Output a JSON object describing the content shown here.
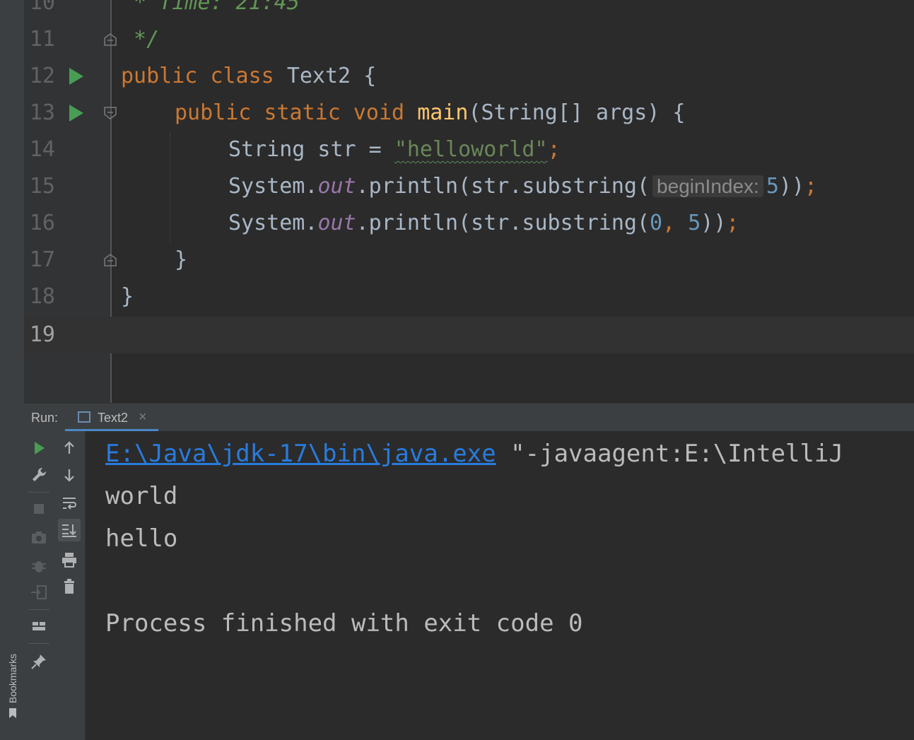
{
  "editor": {
    "lines": [
      {
        "num": "10",
        "text": " * Time: 21:45"
      },
      {
        "num": "11",
        "text": " */"
      },
      {
        "num": "12",
        "kw1": "public",
        "kw2": "class",
        "name": "Text2",
        "brace": "{"
      },
      {
        "num": "13",
        "kw1": "public",
        "kw2": "static",
        "kw3": "void",
        "fn": "main",
        "params": "(String[] args) {"
      },
      {
        "num": "14",
        "type": "String str = ",
        "str": "\"helloworld\"",
        "semi": ";"
      },
      {
        "num": "15",
        "pre": "System.",
        "field": "out",
        "call": ".println(str.substring(",
        "hint": "beginIndex:",
        "arg": "5",
        "close": "))",
        "semi": ";"
      },
      {
        "num": "16",
        "pre": "System.",
        "field": "out",
        "call": ".println(str.substring(",
        "arg1": "0",
        "comma": ", ",
        "arg2": "5",
        "close": "))",
        "semi": ";"
      },
      {
        "num": "17",
        "text": "}"
      },
      {
        "num": "18",
        "text": "}"
      },
      {
        "num": "19",
        "text": ""
      }
    ]
  },
  "run_panel": {
    "label": "Run:",
    "tab_label": "Text2",
    "tab_close": "×"
  },
  "console": {
    "command_link": "E:\\Java\\jdk-17\\bin\\java.exe",
    "command_rest": " \"-javaagent:E:\\IntelliJ",
    "output": [
      "world",
      "hello"
    ],
    "exit_message": "Process finished with exit code 0"
  },
  "side": {
    "bookmarks_label": "Bookmarks"
  },
  "colors": {
    "keyword": "#cc7832",
    "string": "#6a8759",
    "number": "#6897bb",
    "function": "#ffc66d",
    "field": "#9876aa",
    "link": "#287bde",
    "run_green": "#499c54"
  }
}
